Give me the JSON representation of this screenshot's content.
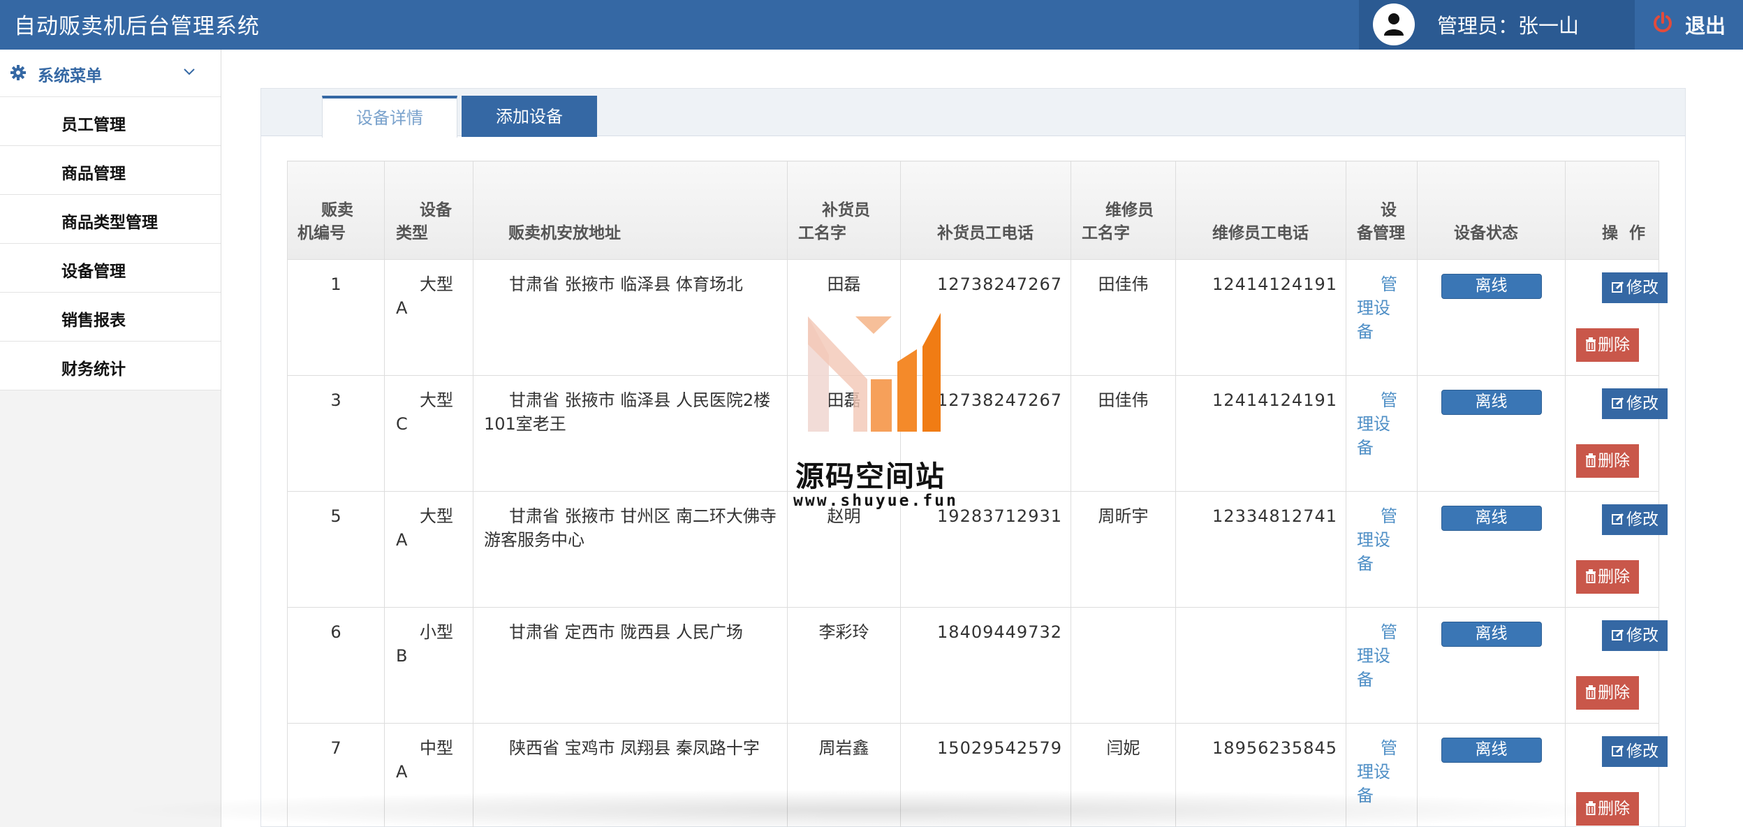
{
  "header": {
    "title": "自动贩卖机后台管理系统",
    "user_label": "管理员：张一山",
    "logout_label": "退出"
  },
  "sidebar": {
    "menu_title": "系统菜单",
    "items": [
      {
        "label": "员工管理"
      },
      {
        "label": "商品管理"
      },
      {
        "label": "商品类型管理"
      },
      {
        "label": "设备管理"
      },
      {
        "label": "销售报表"
      },
      {
        "label": "财务统计"
      }
    ]
  },
  "tabs": {
    "detail": "设备详情",
    "add": "添加设备"
  },
  "table": {
    "headers": {
      "id": "贩卖机编号",
      "type": "设备类型",
      "address": "贩卖机安放地址",
      "restocker": "补货员工名字",
      "restocker_tel": "补货员工电话",
      "repairer": "维修员工名字",
      "repairer_tel": "维修员工电话",
      "manage": "设备管理",
      "status": "设备状态",
      "ops": "操  作"
    },
    "rows": [
      {
        "id": "1",
        "type": "大型A",
        "address": "甘肃省 张掖市 临泽县 体育场北",
        "restocker": "田磊",
        "restocker_tel": "12738247267",
        "repairer": "田佳伟",
        "repairer_tel": "12414124191",
        "manage": "管理设备",
        "status": "离线",
        "edit": "修改",
        "delete": "删除"
      },
      {
        "id": "3",
        "type": "大型C",
        "address": "甘肃省 张掖市 临泽县 人民医院2楼101室老王",
        "restocker": "田磊",
        "restocker_tel": "12738247267",
        "repairer": "田佳伟",
        "repairer_tel": "12414124191",
        "manage": "管理设备",
        "status": "离线",
        "edit": "修改",
        "delete": "删除"
      },
      {
        "id": "5",
        "type": "大型A",
        "address": "甘肃省 张掖市 甘州区 南二环大佛寺游客服务中心",
        "restocker": "赵明",
        "restocker_tel": "19283712931",
        "repairer": "周昕宇",
        "repairer_tel": "12334812741",
        "manage": "管理设备",
        "status": "离线",
        "edit": "修改",
        "delete": "删除"
      },
      {
        "id": "6",
        "type": "小型B",
        "address": "甘肃省 定西市 陇西县 人民广场",
        "restocker": "李彩玲",
        "restocker_tel": "18409449732",
        "repairer": "",
        "repairer_tel": "",
        "manage": "管理设备",
        "status": "离线",
        "edit": "修改",
        "delete": "删除"
      },
      {
        "id": "7",
        "type": "中型A",
        "address": "陕西省 宝鸡市 凤翔县 秦凤路十字",
        "restocker": "周岩鑫",
        "restocker_tel": "15029542579",
        "repairer": "闫妮",
        "repairer_tel": "18956235845",
        "manage": "管理设备",
        "status": "离线",
        "edit": "修改",
        "delete": "删除"
      }
    ]
  },
  "watermark": {
    "text": "源码空间站",
    "url": "www.shuyue.fun"
  },
  "colors": {
    "header_bg": "#3568a4",
    "user_box_bg": "#2b5a92",
    "status_blue": "#3a76b5",
    "delete_red": "#c9574a",
    "link_blue": "#4f8fc6"
  },
  "icons": {
    "avatar": "user-icon",
    "logout": "power-icon",
    "menu": "gear-icon",
    "collapse": "chevron-down-icon",
    "edit": "edit-icon",
    "delete": "trash-icon"
  }
}
